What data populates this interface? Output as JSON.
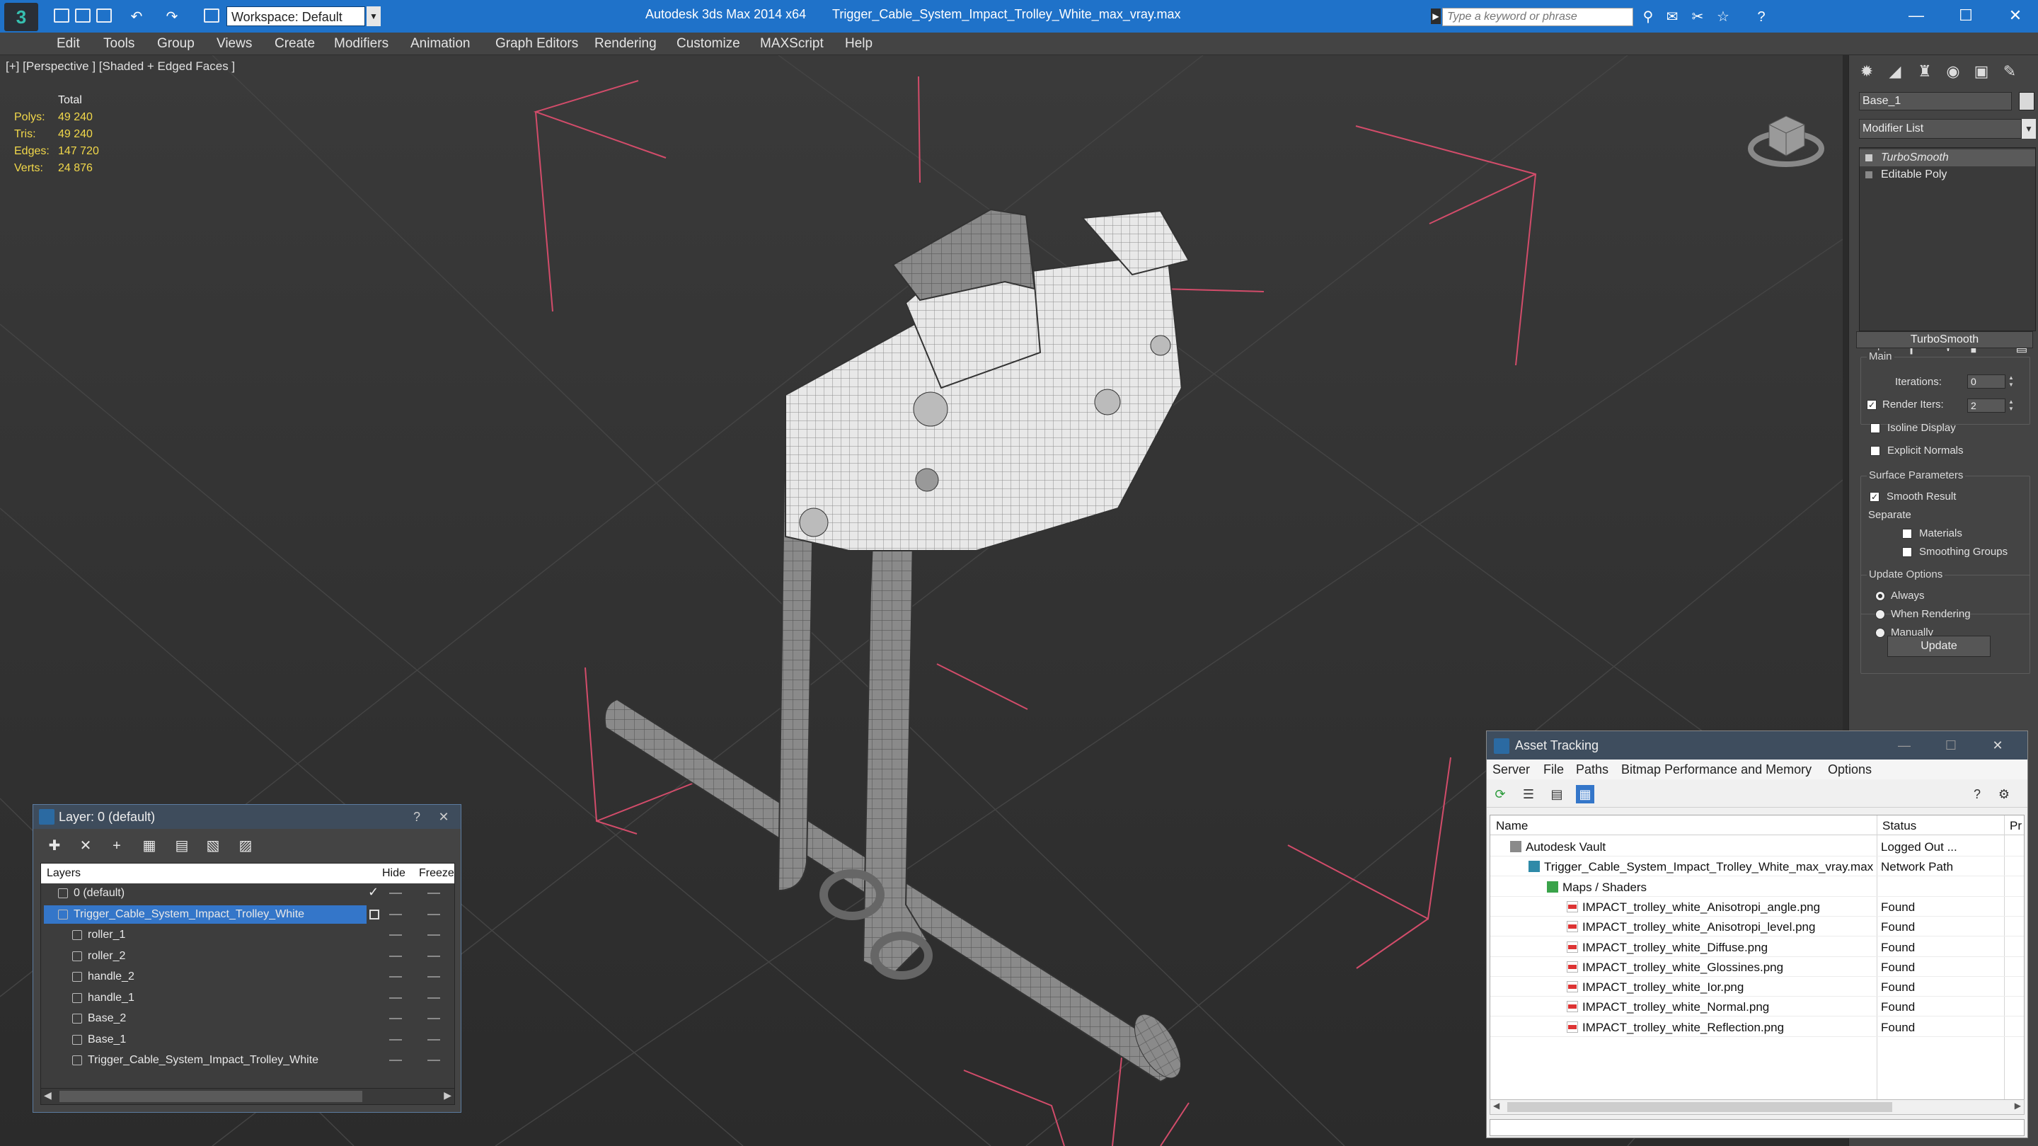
{
  "titlebar": {
    "app_title": "Autodesk 3ds Max  2014 x64",
    "file_title": "Trigger_Cable_System_Impact_Trolley_White_max_vray.max",
    "workspace": "Workspace: Default",
    "search_placeholder": "Type a keyword or phrase",
    "logo_letter": "3",
    "window_buttons": [
      "—",
      "☐",
      "✕"
    ]
  },
  "menu": [
    "Edit",
    "Tools",
    "Group",
    "Views",
    "Create",
    "Modifiers",
    "Animation",
    "Graph Editors",
    "Rendering",
    "Customize",
    "MAXScript",
    "Help"
  ],
  "viewport": {
    "label": "[+] [Perspective ] [Shaded + Edged Faces ]",
    "stats_header": "Total",
    "stats": [
      {
        "label": "Polys:",
        "value": "49 240"
      },
      {
        "label": "Tris:",
        "value": "49 240"
      },
      {
        "label": "Edges:",
        "value": "147 720"
      },
      {
        "label": "Verts:",
        "value": "24 876"
      }
    ]
  },
  "command_panel": {
    "object_name": "Base_1",
    "modifier_list": "Modifier List",
    "stack": [
      "TurboSmooth",
      "Editable Poly"
    ],
    "rollout_title": "TurboSmooth",
    "main_group": "Main",
    "iterations_label": "Iterations:",
    "iterations_value": "0",
    "render_iters_label": "Render Iters:",
    "render_iters_value": "2",
    "isoline": "Isoline Display",
    "explicit_normals": "Explicit Normals",
    "surface_group": "Surface Parameters",
    "smooth_result": "Smooth Result",
    "separate": "Separate",
    "materials": "Materials",
    "smoothing_groups": "Smoothing Groups",
    "update_group": "Update Options",
    "always": "Always",
    "when_rendering": "When Rendering",
    "manually": "Manually",
    "update_button": "Update"
  },
  "layer_dialog": {
    "title": "Layer: 0 (default)",
    "help": "?",
    "close": "✕",
    "col_layers": "Layers",
    "col_hide": "Hide",
    "col_freeze": "Freeze",
    "rows": [
      {
        "name": "0 (default)"
      },
      {
        "name": "Trigger_Cable_System_Impact_Trolley_White"
      },
      {
        "name": "roller_1"
      },
      {
        "name": "roller_2"
      },
      {
        "name": "handle_2"
      },
      {
        "name": "handle_1"
      },
      {
        "name": "Base_2"
      },
      {
        "name": "Base_1"
      },
      {
        "name": "Trigger_Cable_System_Impact_Trolley_White"
      }
    ]
  },
  "asset_tracking": {
    "title": "Asset Tracking",
    "menu": [
      "Server",
      "File",
      "Paths",
      "Bitmap Performance and Memory",
      "Options"
    ],
    "col_name": "Name",
    "col_status": "Status",
    "col_extra": "Pr",
    "rows": [
      {
        "name": "Autodesk Vault",
        "status": "Logged Out ..."
      },
      {
        "name": "Trigger_Cable_System_Impact_Trolley_White_max_vray.max",
        "status": "Network Path"
      },
      {
        "name": "Maps / Shaders",
        "status": ""
      },
      {
        "name": "IMPACT_trolley_white_Anisotropi_angle.png",
        "status": "Found"
      },
      {
        "name": "IMPACT_trolley_white_Anisotropi_level.png",
        "status": "Found"
      },
      {
        "name": "IMPACT_trolley_white_Diffuse.png",
        "status": "Found"
      },
      {
        "name": "IMPACT_trolley_white_Glossines.png",
        "status": "Found"
      },
      {
        "name": "IMPACT_trolley_white_Ior.png",
        "status": "Found"
      },
      {
        "name": "IMPACT_trolley_white_Normal.png",
        "status": "Found"
      },
      {
        "name": "IMPACT_trolley_white_Reflection.png",
        "status": "Found"
      }
    ]
  },
  "colors": {
    "titlebar": "#1f72c9",
    "selection": "#3476c9",
    "stats_text": "#f2d84a",
    "bbox_lines": "#d24c6a"
  }
}
